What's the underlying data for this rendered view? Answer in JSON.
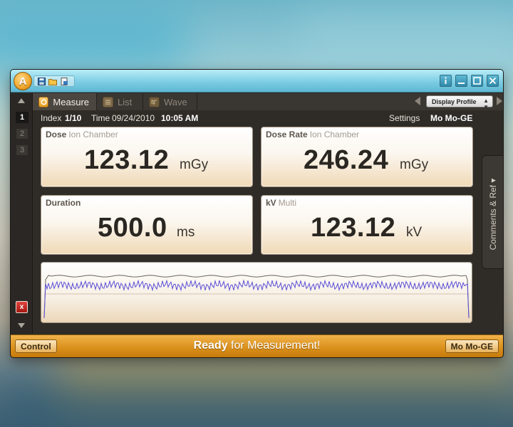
{
  "app": {
    "logo_letter": "A"
  },
  "titlebar": {
    "tools": [
      "save-icon",
      "open-folder-icon",
      "export-icon"
    ],
    "controls": [
      "info-icon",
      "minimize-icon",
      "maximize-icon",
      "close-icon"
    ]
  },
  "tabs": [
    {
      "label": "Measure",
      "active": true,
      "icon": "measure-icon"
    },
    {
      "label": "List",
      "active": false,
      "icon": "list-icon"
    },
    {
      "label": "Wave",
      "active": false,
      "icon": "wave-icon"
    }
  ],
  "profile": {
    "selected": "Display Profile"
  },
  "sidebar": {
    "items": [
      "1",
      "2",
      "3"
    ],
    "active_index": 0,
    "delete_label": "x"
  },
  "info": {
    "index_label": "Index",
    "index_value": "1/10",
    "time_label": "Time",
    "date": "09/24/2010",
    "time": "10:05 AM",
    "settings_label": "Settings",
    "settings_value": "Mo Mo-GE"
  },
  "panels": {
    "dose": {
      "label": "Dose",
      "sub": "Ion Chamber",
      "value": "123.12",
      "unit": "mGy"
    },
    "dose_rate": {
      "label": "Dose Rate",
      "sub": "Ion Chamber",
      "value": "246.24",
      "unit": "mGy"
    },
    "duration": {
      "label": "Duration",
      "sub": "",
      "value": "500.0",
      "unit": "ms"
    },
    "kv": {
      "label": "kV",
      "sub": "Multi",
      "value": "123.12",
      "unit": "kV"
    }
  },
  "side_tab": {
    "label": "Comments & Ref ▾"
  },
  "status": {
    "control_label": "Control",
    "message_bold": "Ready",
    "message_rest": " for Measurement!",
    "profile_button": "Mo Mo-GE"
  },
  "colors": {
    "accent_orange": "#d98f1a",
    "title_blue": "#7ccde4",
    "wave_purple": "#5b4fd6",
    "delete_red": "#c4231b"
  }
}
